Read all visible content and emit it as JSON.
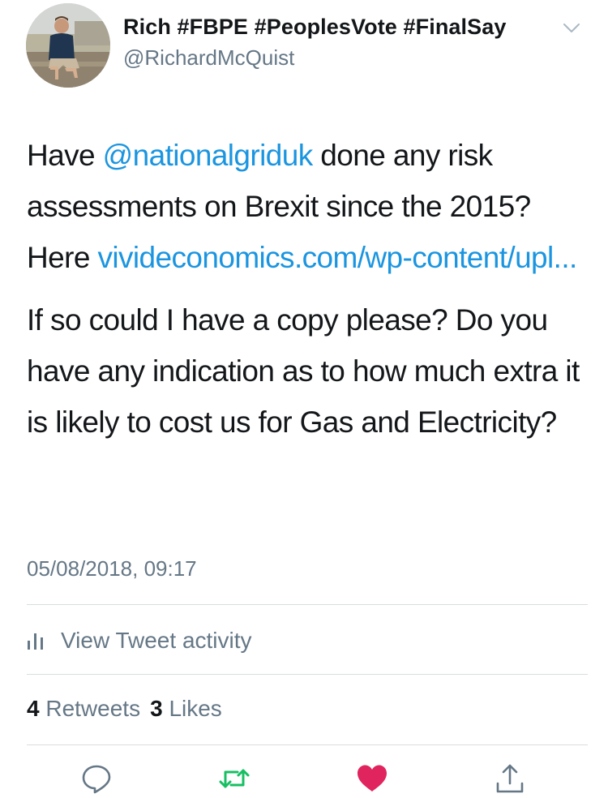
{
  "author": {
    "display_name": "Rich #FBPE #PeoplesVote #FinalSay",
    "handle": "@RichardMcQuist"
  },
  "tweet": {
    "p1_pre": "Have ",
    "p1_mention": "@nationalgriduk",
    "p1_mid": " done any risk assessments on Brexit since the 2015? Here ",
    "p1_link": "vivideconomics.com/wp-content/upl...",
    "p2": "If so could I have a copy please? Do you have any indication as to how much extra it is likely to cost us for Gas and Electricity?",
    "timestamp": "05/08/2018, 09:17"
  },
  "activity": {
    "label": "View Tweet activity",
    "icon": "bar-chart-icon"
  },
  "stats": {
    "retweets_count": "4",
    "retweets_label": "Retweets",
    "likes_count": "3",
    "likes_label": "Likes"
  },
  "actions": [
    {
      "name": "reply",
      "icon": "speech-bubble-icon"
    },
    {
      "name": "retweet",
      "icon": "retweet-arrows-icon"
    },
    {
      "name": "like",
      "icon": "heart-icon"
    },
    {
      "name": "share",
      "icon": "share-upload-icon"
    }
  ],
  "colors": {
    "link": "#1b95e0",
    "secondary_text": "#657786",
    "retweet_active": "#17bf63",
    "like_active": "#e0245e",
    "icon_gray": "#657786"
  }
}
